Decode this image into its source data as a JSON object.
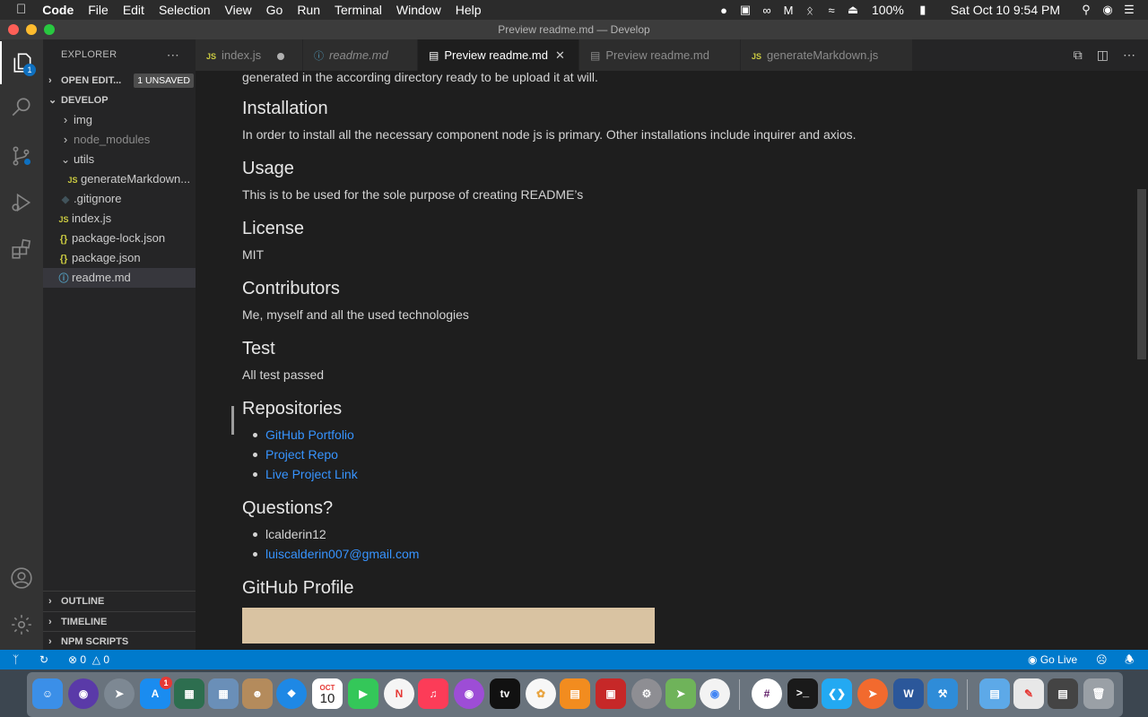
{
  "menubar": {
    "app": "Code",
    "items": [
      "File",
      "Edit",
      "Selection",
      "View",
      "Go",
      "Run",
      "Terminal",
      "Window",
      "Help"
    ],
    "battery": "100%",
    "clock": "Sat Oct 10  9:54 PM"
  },
  "window": {
    "title": "Preview readme.md — Develop"
  },
  "activity": {
    "explorer_badge": "1"
  },
  "explorer": {
    "title": "EXPLORER",
    "open_editors": "OPEN EDIT...",
    "unsaved": "1 UNSAVED",
    "folder": "DEVELOP",
    "items": [
      {
        "label": "img",
        "icon": "chevron-right",
        "indent": 1
      },
      {
        "label": "node_modules",
        "icon": "chevron-right",
        "indent": 1
      },
      {
        "label": "utils",
        "icon": "chevron-down",
        "indent": 1
      },
      {
        "label": "generateMarkdown...",
        "icon": "JS",
        "indent": 2
      },
      {
        "label": ".gitignore",
        "icon": "git",
        "indent": 1
      },
      {
        "label": "index.js",
        "icon": "JS",
        "indent": 1
      },
      {
        "label": "package-lock.json",
        "icon": "{}",
        "indent": 1
      },
      {
        "label": "package.json",
        "icon": "{}",
        "indent": 1
      },
      {
        "label": "readme.md",
        "icon": "info",
        "indent": 1
      }
    ],
    "outline": "OUTLINE",
    "timeline": "TIMELINE",
    "npm": "NPM SCRIPTS"
  },
  "tabs": [
    {
      "label": "index.js",
      "icon": "JS"
    },
    {
      "label": "readme.md",
      "icon": "info"
    },
    {
      "label": "Preview readme.md",
      "icon": "preview"
    },
    {
      "label": "Preview readme.md",
      "icon": "preview"
    },
    {
      "label": "generateMarkdown.js",
      "icon": "JS"
    }
  ],
  "preview": {
    "top_line": "generated in the according directory ready to be upload it at will.",
    "installation_h": "Installation",
    "installation_p": "In order to install all the necessary component node js is primary. Other installations include inquirer and axios.",
    "usage_h": "Usage",
    "usage_p": "This is to be used for the sole purpose of creating README’s",
    "license_h": "License",
    "license_p": "MIT",
    "contributors_h": "Contributors",
    "contributors_p": "Me, myself and all the used technologies",
    "test_h": "Test",
    "test_p": "All test passed",
    "repos_h": "Repositories",
    "repos": [
      "GitHub Portfolio",
      "Project Repo",
      "Live Project Link"
    ],
    "questions_h": "Questions?",
    "username": "lcalderin12",
    "email": "luiscalderin007@gmail.com",
    "profile_h": "GitHub Profile"
  },
  "status": {
    "errors": "0",
    "warnings": "0",
    "golive": "Go Live"
  },
  "dock": {
    "appstore_badge": "1",
    "calendar_month": "OCT",
    "calendar_day": "10"
  },
  "colors": {
    "accent": "#007acc",
    "link": "#3794ff",
    "js": "#cbcb41"
  }
}
